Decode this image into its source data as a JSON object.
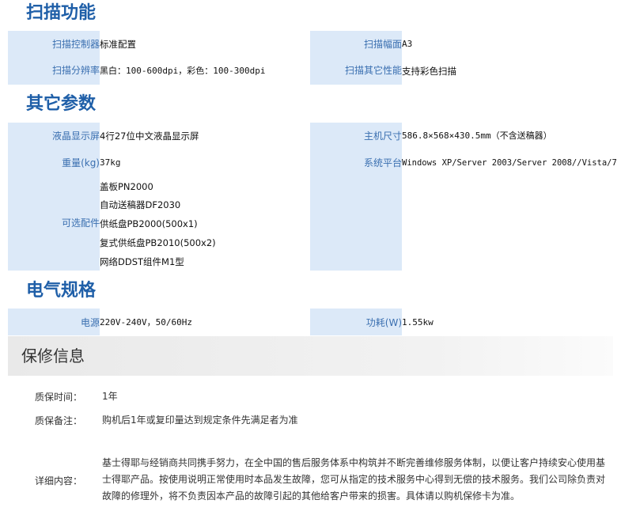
{
  "sections": {
    "scan": {
      "title": "扫描功能",
      "rows": [
        {
          "left_label": "扫描控制器",
          "left_value": "标准配置",
          "right_label": "扫描幅面",
          "right_value": "A3"
        },
        {
          "left_label": "扫描分辨率",
          "left_value": "黑白：100-600dpi，彩色：100-300dpi",
          "right_label": "扫描其它性能",
          "right_value": "支持彩色扫描"
        }
      ]
    },
    "other": {
      "title": "其它参数",
      "rows": [
        {
          "left_label": "液晶显示屏",
          "left_value": "4行27位中文液晶显示屏",
          "right_label": "主机尺寸",
          "right_value": "586.8×568×430.5mm（不含送稿器）"
        },
        {
          "left_label": "重量(kg)",
          "left_value": "37kg",
          "right_label": "系统平台",
          "right_value": "Windows XP/Server 2003/Server 2008//Vista/7"
        }
      ],
      "options_label": "可选配件",
      "options": [
        "盖板PN2000",
        "自动送稿器DF2030",
        "供纸盘PB2000(500x1)",
        "复式供纸盘PB2010(500x2)",
        "网络DDST组件M1型"
      ]
    },
    "electric": {
      "title": "电气规格",
      "rows": [
        {
          "left_label": "电源",
          "left_value": "220V-240V，50/60Hz",
          "right_label": "功耗(W)",
          "right_value": "1.55kw"
        }
      ]
    }
  },
  "warranty": {
    "title": "保修信息",
    "period_label": "质保时间：",
    "period_value": "1年",
    "note_label": "质保备注：",
    "note_value": "购机后1年或复印量达到规定条件先满足者为准",
    "detail_label": "详细内容：",
    "detail_value": "基士得耶与经销商共同携手努力，在全中国的售后服务体系中构筑并不断完善维修服务体制，以便让客户持续安心使用基士得耶产品。按使用说明正常使用时本品发生故障，您可从指定的技术服务中心得到无偿的技术服务。我们公司除负责对故障的修理外，将不负责因本产品的故障引起的其他给客户带来的损害。具体请以购机保修卡为准。"
  },
  "colors": {
    "section_title": "#1f5fa8",
    "label_text": "#3a6fb0",
    "label_background": "#dce9f8"
  }
}
